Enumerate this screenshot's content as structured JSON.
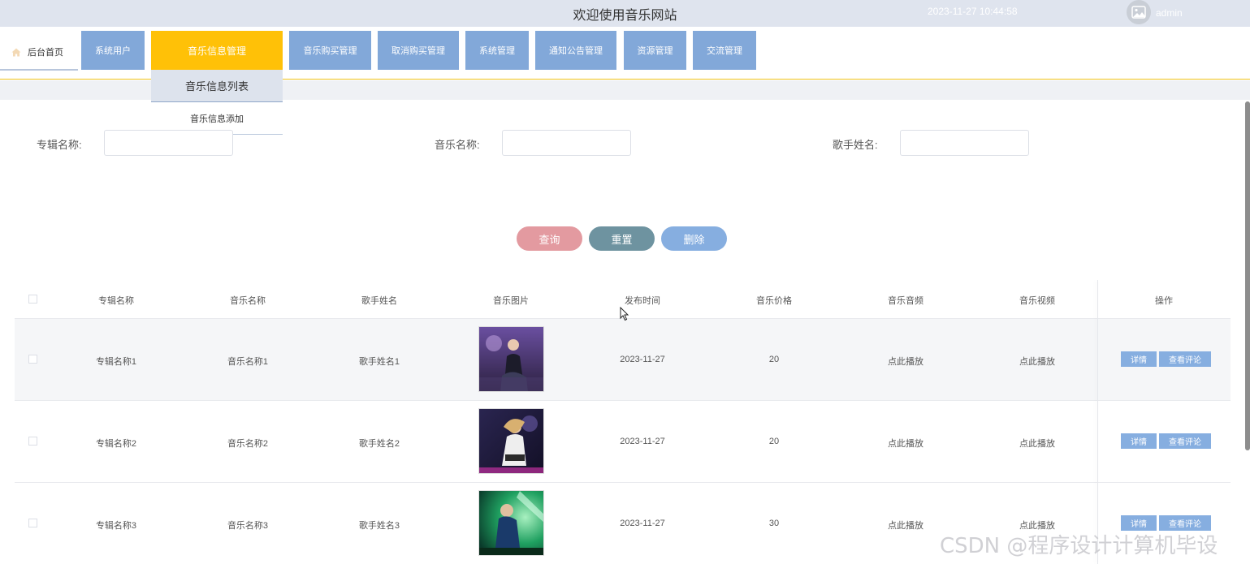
{
  "header": {
    "title": "欢迎使用音乐网站",
    "datetime": "2023-11-27 10:44:58",
    "username": "admin"
  },
  "nav": {
    "home_label": "后台首页",
    "items": [
      {
        "label": "系统用户",
        "active": false
      },
      {
        "label": "音乐信息管理",
        "active": true
      },
      {
        "label": "音乐购买管理",
        "active": false
      },
      {
        "label": "取消购买管理",
        "active": false
      },
      {
        "label": "系统管理",
        "active": false
      },
      {
        "label": "通知公告管理",
        "active": false
      },
      {
        "label": "资源管理",
        "active": false
      },
      {
        "label": "交流管理",
        "active": false
      }
    ],
    "dropdown": [
      "音乐信息列表",
      "音乐信息添加"
    ]
  },
  "search": {
    "album_label": "专辑名称:",
    "album_value": "",
    "music_label": "音乐名称:",
    "music_value": "",
    "singer_label": "歌手姓名:",
    "singer_value": ""
  },
  "buttons": {
    "query": "查询",
    "reset": "重置",
    "delete": "删除"
  },
  "table": {
    "columns": [
      "专辑名称",
      "音乐名称",
      "歌手姓名",
      "音乐图片",
      "发布时间",
      "音乐价格",
      "音乐音频",
      "音乐视频",
      "操作"
    ],
    "rows": [
      {
        "album": "专辑名称1",
        "music": "音乐名称1",
        "singer": "歌手姓名1",
        "date": "2023-11-27",
        "price": "20",
        "audio": "点此播放",
        "video": "点此播放",
        "detail": "详情",
        "comments": "查看评论"
      },
      {
        "album": "专辑名称2",
        "music": "音乐名称2",
        "singer": "歌手姓名2",
        "date": "2023-11-27",
        "price": "20",
        "audio": "点此播放",
        "video": "点此播放",
        "detail": "详情",
        "comments": "查看评论"
      },
      {
        "album": "专辑名称3",
        "music": "音乐名称3",
        "singer": "歌手姓名3",
        "date": "2023-11-27",
        "price": "30",
        "audio": "点此播放",
        "video": "点此播放",
        "detail": "详情",
        "comments": "查看评论"
      }
    ]
  },
  "watermark": "CSDN @程序设计计算机毕设",
  "colors": {
    "nav_default": "#82a8d9",
    "nav_active": "#ffc107",
    "query_button": "#e39aa0",
    "reset_button": "#6e93a0",
    "delete_button": "#86aee0"
  }
}
